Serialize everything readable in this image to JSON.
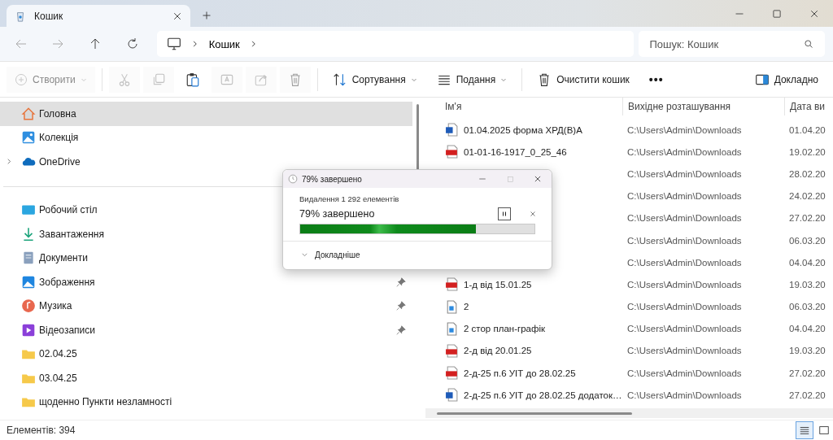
{
  "tab": {
    "title": "Кошик"
  },
  "address": {
    "segments": [
      "Кошик"
    ]
  },
  "search": {
    "placeholder": "Пошук: Кошик"
  },
  "toolbar": {
    "items": [
      {
        "kind": "create",
        "label": "Створити",
        "disabled": true
      },
      {
        "kind": "cut",
        "disabled": true
      },
      {
        "kind": "copy",
        "disabled": true
      },
      {
        "kind": "paste",
        "disabled": false
      },
      {
        "kind": "rename",
        "disabled": true
      },
      {
        "kind": "share",
        "disabled": true
      },
      {
        "kind": "delete",
        "disabled": true
      },
      {
        "kind": "sort",
        "label": "Сортування",
        "disabled": false
      },
      {
        "kind": "view",
        "label": "Подання",
        "disabled": false
      },
      {
        "kind": "empty",
        "label": "Очистити кошик",
        "disabled": false
      },
      {
        "kind": "more",
        "label": "•••",
        "disabled": false
      }
    ],
    "details": "Докладно"
  },
  "sidebar": {
    "top": [
      {
        "kind": "home",
        "label": "Головна",
        "selected": true,
        "expandable": false
      },
      {
        "kind": "gallery",
        "label": "Колекція",
        "selected": false,
        "expandable": false
      },
      {
        "kind": "cloud",
        "label": "OneDrive",
        "selected": false,
        "expandable": true
      }
    ],
    "quick": [
      {
        "kind": "desktop",
        "label": "Робочий стіл",
        "selected": false
      },
      {
        "kind": "download",
        "label": "Завантаження",
        "selected": false
      },
      {
        "kind": "documents",
        "label": "Документи",
        "selected": false
      },
      {
        "kind": "pictures",
        "label": "Зображення",
        "selected": false,
        "pinned": true
      },
      {
        "kind": "music",
        "label": "Музика",
        "selected": false,
        "pinned": true
      },
      {
        "kind": "video",
        "label": "Відеозаписи",
        "selected": false,
        "pinned": true
      },
      {
        "kind": "folder",
        "label": "02.04.25",
        "selected": false,
        "pinned": false
      },
      {
        "kind": "folder",
        "label": "03.04.25",
        "selected": false,
        "pinned": false
      },
      {
        "kind": "folder",
        "label": "щоденно Пункти незламності",
        "selected": false,
        "pinned": false
      }
    ]
  },
  "files": {
    "columns": [
      "Ім'я",
      "Вихідне розташування",
      "Дата ви"
    ],
    "rows": [
      {
        "kind": "word",
        "name": "01.04.2025 форма ХРД(В)А",
        "location": "C:\\Users\\Admin\\Downloads",
        "date": "01.04.20"
      },
      {
        "kind": "pdf",
        "name": "01-01-16-1917_0_25_46",
        "location": "C:\\Users\\Admin\\Downloads",
        "date": "19.02.20"
      },
      {
        "kind": "hidden",
        "location": "C:\\Users\\Admin\\Downloads",
        "date": "28.02.20"
      },
      {
        "kind": "hidden",
        "location": "C:\\Users\\Admin\\Downloads",
        "date": "24.02.20"
      },
      {
        "kind": "hidden",
        "location": "C:\\Users\\Admin\\Downloads",
        "date": "27.02.20"
      },
      {
        "kind": "hidden",
        "location": "C:\\Users\\Admin\\Downloads",
        "date": "06.03.20"
      },
      {
        "kind": "hidden",
        "location": "C:\\Users\\Admin\\Downloads",
        "date": "04.04.20"
      },
      {
        "kind": "pdf",
        "name": "1-д від 15.01.25",
        "location": "C:\\Users\\Admin\\Downloads",
        "date": "19.03.20"
      },
      {
        "kind": "image",
        "name": "2",
        "location": "C:\\Users\\Admin\\Downloads",
        "date": "06.03.20"
      },
      {
        "kind": "image",
        "name": "2 стор план-графік",
        "location": "C:\\Users\\Admin\\Downloads",
        "date": "04.04.20"
      },
      {
        "kind": "pdf",
        "name": "2-д від 20.01.25",
        "location": "C:\\Users\\Admin\\Downloads",
        "date": "19.03.20"
      },
      {
        "kind": "pdf",
        "name": "2-д-25 п.6 УІТ до 28.02.25",
        "location": "C:\\Users\\Admin\\Downloads",
        "date": "27.02.20"
      },
      {
        "kind": "word",
        "name": "2-д-25 п.6 УІТ до 28.02.25 додаток…",
        "location": "C:\\Users\\Admin\\Downloads",
        "date": "27.02.20"
      }
    ]
  },
  "dialog": {
    "title": "79% завершено",
    "operation": "Видалення 1 292 елементів",
    "status": "79% завершено",
    "level": 0.75,
    "more": "Докладніше"
  },
  "status_bar": {
    "count": "Елементів: 394",
    "views": [
      {
        "kind": "details",
        "selected": true
      },
      {
        "kind": "tiles",
        "selected": false
      }
    ]
  }
}
